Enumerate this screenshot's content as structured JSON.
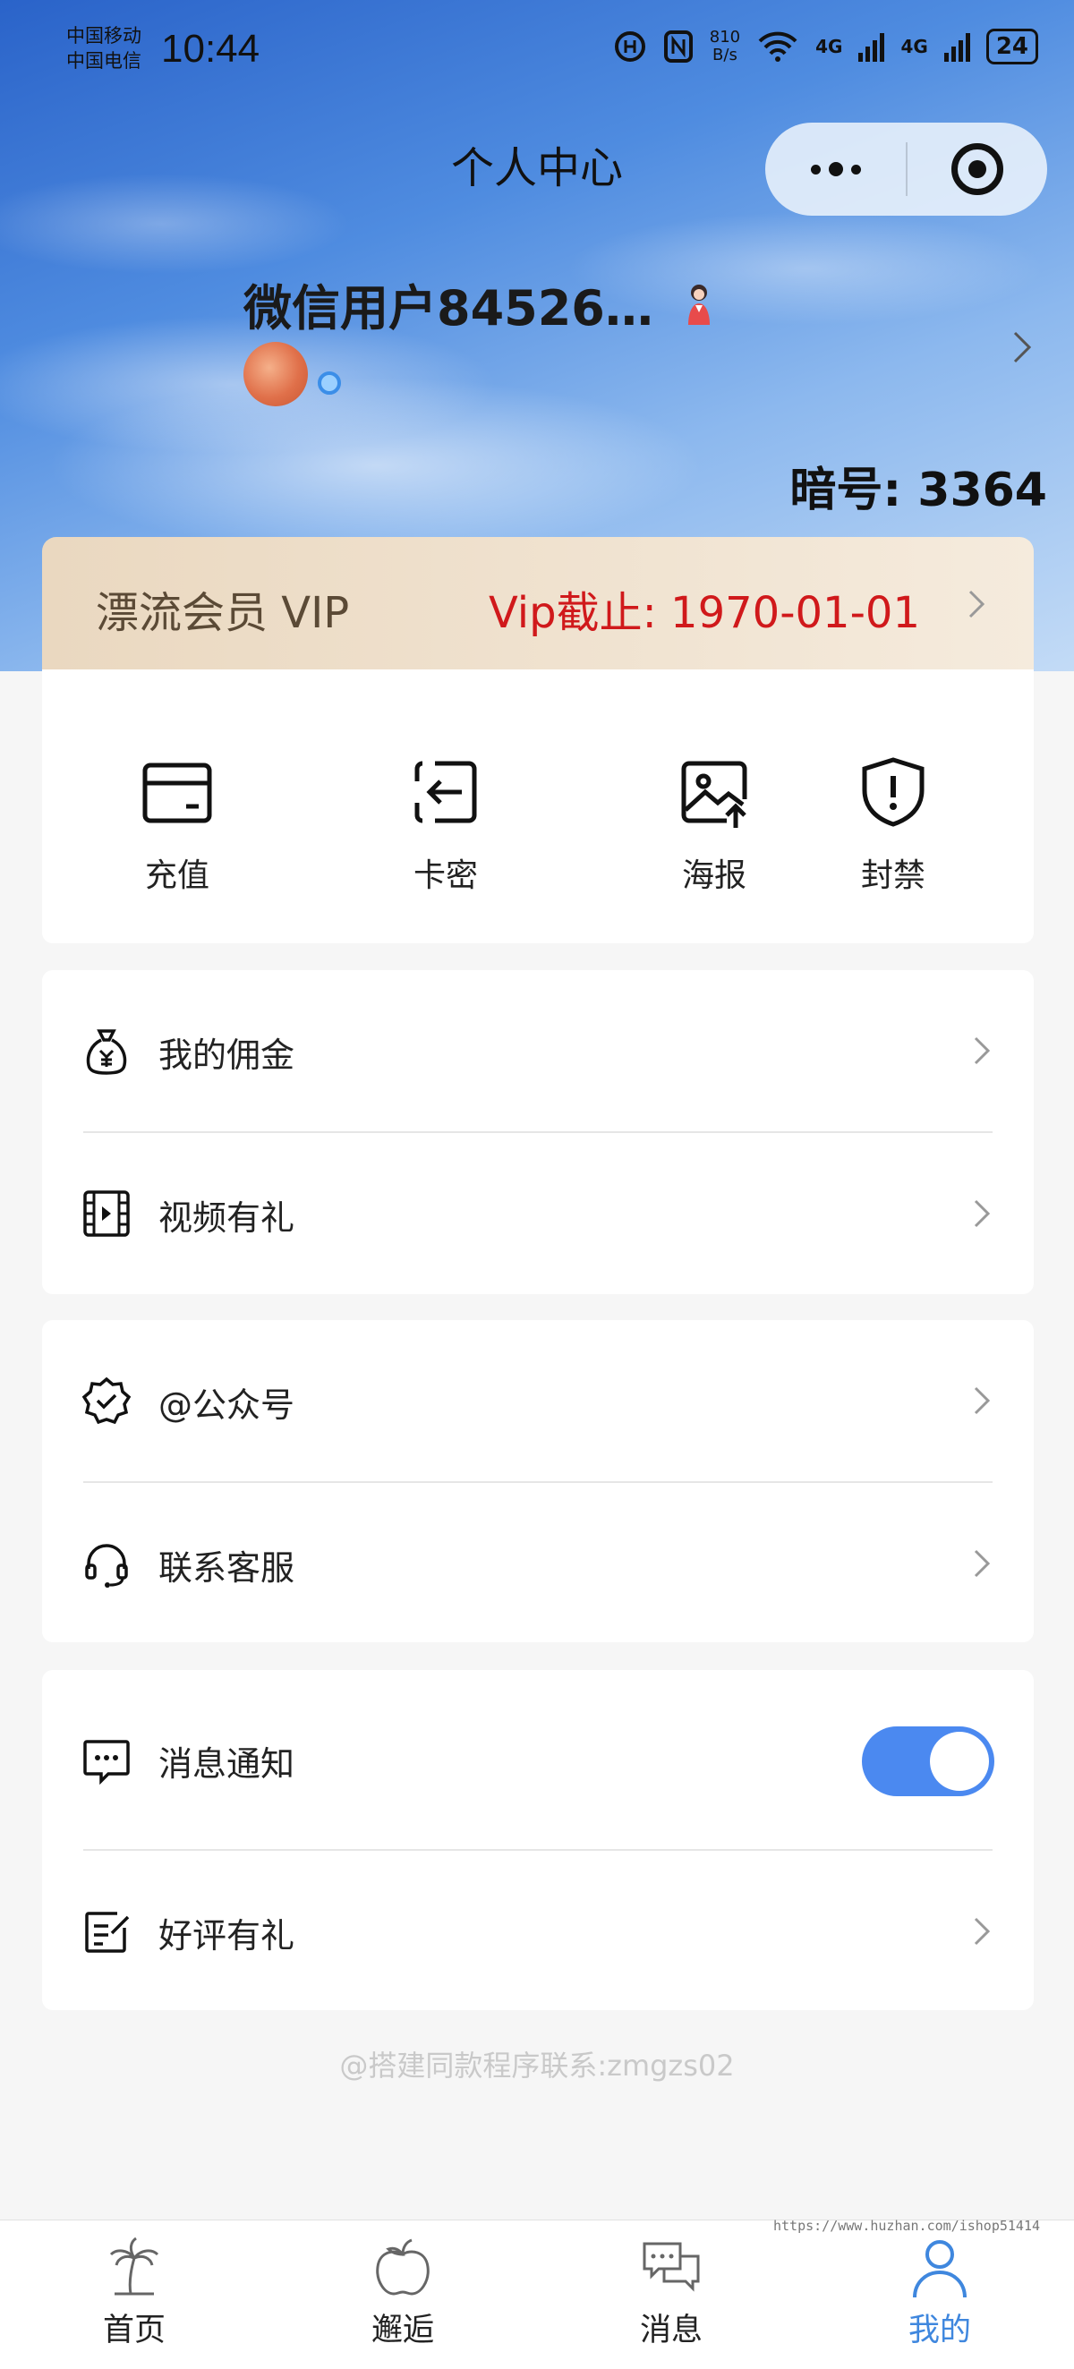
{
  "status_bar": {
    "carrier_1": "中国移动",
    "carrier_2": "中国电信",
    "time": "10:44",
    "net_speed_value": "810",
    "net_speed_unit": "B/s",
    "network_1": "4G",
    "network_2": "4G",
    "battery": "24"
  },
  "header": {
    "title": "个人中心"
  },
  "profile": {
    "username": "微信用户84526…",
    "secret_code": "暗号: 3364"
  },
  "vip": {
    "title": "漂流会员 VIP",
    "expiry": "Vip截止: 1970-01-01"
  },
  "quick_actions": [
    {
      "label": "充值",
      "icon": "wallet-icon"
    },
    {
      "label": "卡密",
      "icon": "card-key-icon"
    },
    {
      "label": "海报",
      "icon": "poster-icon"
    },
    {
      "label": "封禁",
      "icon": "ban-shield-icon"
    }
  ],
  "menu": {
    "commission": "我的佣金",
    "video_gift": "视频有礼",
    "official_account": "@公众号",
    "customer_service": "联系客服",
    "notifications": "消息通知",
    "notifications_on": true,
    "review_gift": "好评有礼"
  },
  "footer_note": "@搭建同款程序联系:zmgzs02",
  "watermark": "https://www.huzhan.com/ishop51414",
  "tabbar": [
    {
      "label": "首页",
      "icon": "palm-tree-icon",
      "active": false
    },
    {
      "label": "邂逅",
      "icon": "apple-icon",
      "active": false
    },
    {
      "label": "消息",
      "icon": "chat-icon",
      "active": false
    },
    {
      "label": "我的",
      "icon": "person-icon",
      "active": true
    }
  ],
  "colors": {
    "accent_blue": "#4b89f0",
    "vip_red": "#d0191b",
    "tab_active": "#3f87de"
  }
}
